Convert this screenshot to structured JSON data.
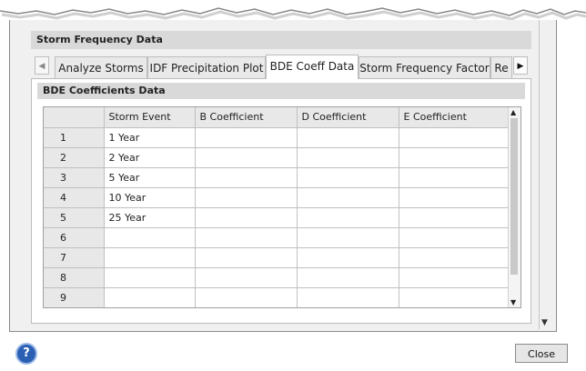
{
  "panel": {
    "title": "Storm Frequency Data"
  },
  "tabs": [
    {
      "label": "Analyze Storms"
    },
    {
      "label": "IDF Precipitation Plot"
    },
    {
      "label": "BDE Coeff Data",
      "active": true
    },
    {
      "label": "Storm Frequency Factor"
    },
    {
      "label": "Re"
    }
  ],
  "section": {
    "title": "BDE Coefficients Data"
  },
  "grid": {
    "columns": [
      "",
      "Storm Event",
      "B Coefficient",
      "D Coefficient",
      "E Coefficient"
    ],
    "rows": [
      [
        "1",
        "1 Year",
        "",
        "",
        ""
      ],
      [
        "2",
        "2 Year",
        "",
        "",
        ""
      ],
      [
        "3",
        "5 Year",
        "",
        "",
        ""
      ],
      [
        "4",
        "10 Year",
        "",
        "",
        ""
      ],
      [
        "5",
        "25 Year",
        "",
        "",
        ""
      ],
      [
        "6",
        "",
        "",
        "",
        ""
      ],
      [
        "7",
        "",
        "",
        "",
        ""
      ],
      [
        "8",
        "",
        "",
        "",
        ""
      ],
      [
        "9",
        "",
        "",
        "",
        ""
      ]
    ]
  },
  "footer": {
    "help_label": "?",
    "close_label": "Close"
  },
  "colors": {
    "header_bg": "#d9d9d9",
    "grid_header_bg": "#e8e8e8",
    "help_blue": "#2b5fb3"
  },
  "icons": {
    "tab_left": "chevron-left-icon",
    "tab_right": "chevron-right-icon",
    "help": "help-icon"
  }
}
